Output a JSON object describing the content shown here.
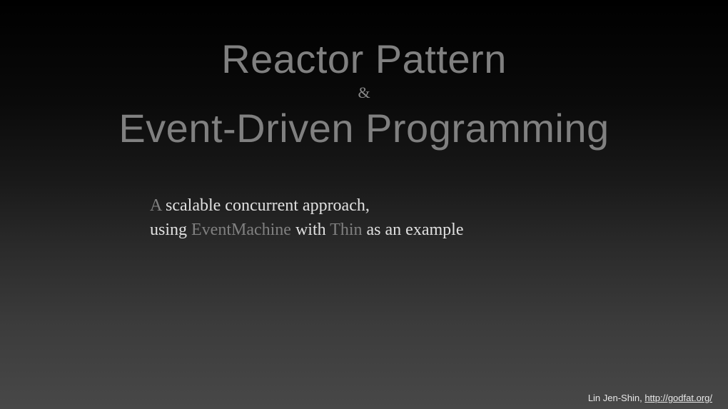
{
  "title": {
    "line1": "Reactor Pattern",
    "amp": "&",
    "line2": "Event-Driven Programming"
  },
  "subtitle": {
    "a": "A",
    "part1": " scalable concurrent approach,",
    "part2a": "using ",
    "em": "EventMachine",
    "part2b": " with ",
    "thin": "Thin",
    "part2c": " as an example"
  },
  "footer": {
    "author": "Lin Jen-Shin, ",
    "link": "http://godfat.org/"
  }
}
